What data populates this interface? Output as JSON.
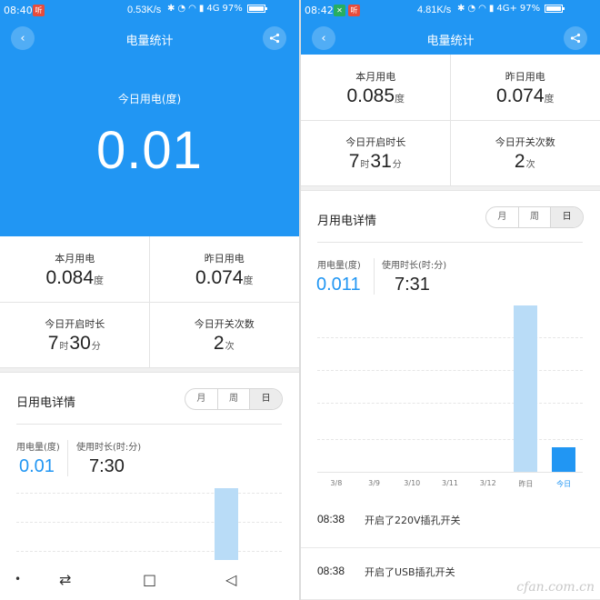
{
  "colors": {
    "primary": "#2196f3",
    "bar_light": "#b9dcf7",
    "bar_active": "#2196f3"
  },
  "left": {
    "status": {
      "time": "08:40",
      "badge": "听",
      "speed": "0.53K/s",
      "network": "4G",
      "battery": "97%"
    },
    "nav": {
      "title": "电量统计",
      "back_icon": "chevron-left-icon",
      "share_icon": "share-icon"
    },
    "hero": {
      "label": "今日用电(度)",
      "value": "0.01"
    },
    "stats": {
      "month_label": "本月用电",
      "month_value": "0.084",
      "month_unit": "度",
      "yesterday_label": "昨日用电",
      "yesterday_value": "0.074",
      "yesterday_unit": "度",
      "on_label": "今日开启时长",
      "on_hours": "7",
      "on_hours_unit": "时",
      "on_minutes": "30",
      "on_minutes_unit": "分",
      "switch_label": "今日开关次数",
      "switch_value": "2",
      "switch_unit": "次"
    },
    "detail": {
      "title": "日用电详情",
      "tabs": [
        "月",
        "周",
        "日"
      ],
      "active_tab": "日",
      "usage_label": "用电量(度)",
      "usage_value": "0.01",
      "duration_label": "使用时长(时:分)",
      "duration_value": "7:30"
    },
    "sysnav": {
      "dot": "•",
      "switch": "⇄",
      "home": "□",
      "back": "◁"
    }
  },
  "right": {
    "status": {
      "time": "08:42",
      "badge1": "✕",
      "badge2": "听",
      "speed": "4.81K/s",
      "network": "4G+",
      "battery": "97%"
    },
    "nav": {
      "title": "电量统计",
      "back_icon": "chevron-left-icon",
      "share_icon": "share-icon"
    },
    "stats": {
      "month_label": "本月用电",
      "month_value": "0.085",
      "month_unit": "度",
      "yesterday_label": "昨日用电",
      "yesterday_value": "0.074",
      "yesterday_unit": "度",
      "on_label": "今日开启时长",
      "on_hours": "7",
      "on_hours_unit": "时",
      "on_minutes": "31",
      "on_minutes_unit": "分",
      "switch_label": "今日开关次数",
      "switch_value": "2",
      "switch_unit": "次"
    },
    "detail": {
      "title": "月用电详情",
      "tabs": [
        "月",
        "周",
        "日"
      ],
      "active_tab": "日",
      "usage_label": "用电量(度)",
      "usage_value": "0.011",
      "duration_label": "使用时长(时:分)",
      "duration_value": "7:31"
    },
    "log": [
      {
        "time": "08:38",
        "text": "开启了220V插孔开关"
      },
      {
        "time": "08:38",
        "text": "开启了USB插孔开关"
      }
    ],
    "watermark": "cfan.com.cn"
  },
  "chart_data": {
    "type": "bar",
    "categories": [
      "3/8",
      "3/9",
      "3/10",
      "3/11",
      "3/12",
      "昨日",
      "今日"
    ],
    "values": [
      0,
      0,
      0,
      0,
      0,
      0.074,
      0.011
    ],
    "highlight": "今日",
    "grid": true
  }
}
